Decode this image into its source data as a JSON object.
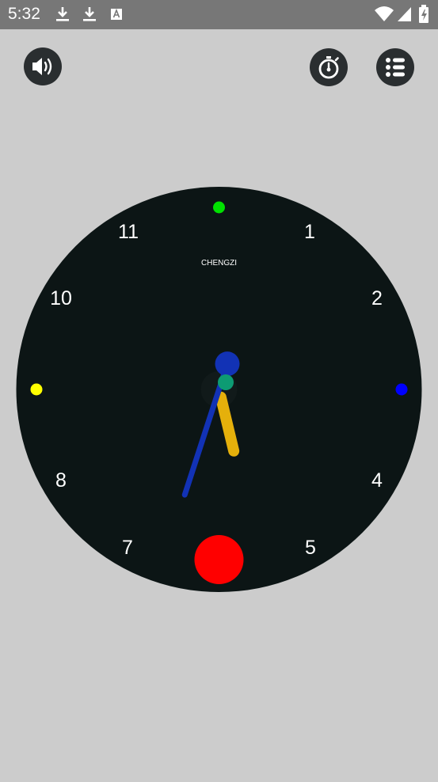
{
  "status_bar": {
    "time": "5:32",
    "left_icons": [
      "download-icon",
      "download-icon",
      "text-notification-icon"
    ],
    "right_icons": [
      "wifi-icon",
      "cell-signal-icon",
      "battery-icon"
    ]
  },
  "toolbar": {
    "sound_icon": "speaker-icon",
    "timer_icon": "stopwatch-icon",
    "menu_icon": "list-menu-icon"
  },
  "clock": {
    "brand": "CHENGZI",
    "hour_labels": [
      "1",
      "2",
      "4",
      "5",
      "7",
      "8",
      "10",
      "11"
    ],
    "time_shown": {
      "hour": 5,
      "minute": 33
    },
    "colors": {
      "background": "#cccccc",
      "dial": "#0c1515",
      "hour_hand": "#e5b00b",
      "minute_hand": "#1232b5",
      "center": "#0d9b73",
      "top_marker": "#00e000",
      "left_marker": "#ffff00",
      "right_marker": "#0000ff",
      "bottom_marker": "#ff0000"
    }
  }
}
